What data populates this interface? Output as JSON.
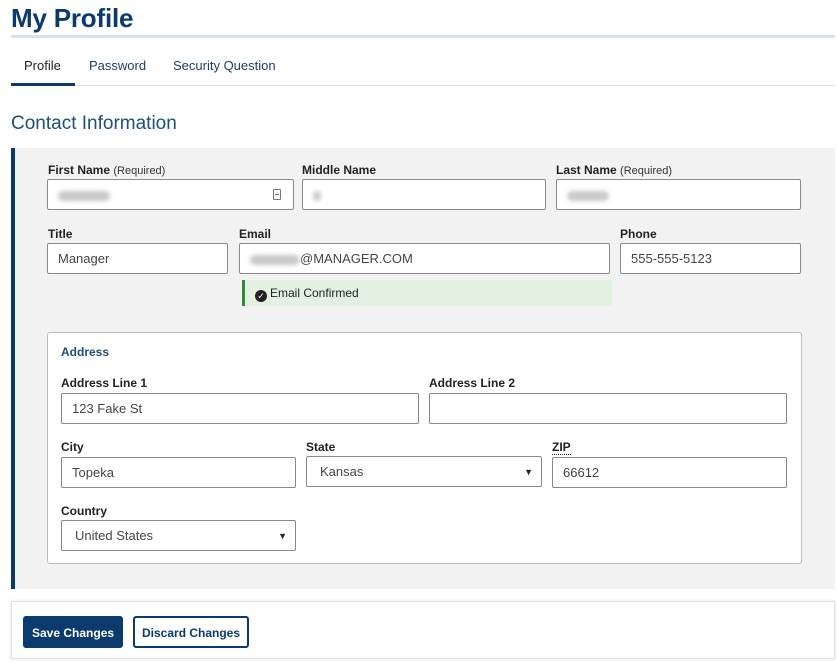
{
  "header": {
    "title": "My Profile"
  },
  "tabs": [
    {
      "label": "Profile",
      "active": true
    },
    {
      "label": "Password",
      "active": false
    },
    {
      "label": "Security Question",
      "active": false
    }
  ],
  "contact": {
    "title": "Contact Information",
    "first_name": {
      "label": "First Name",
      "required": "(Required)",
      "value": ""
    },
    "middle_name": {
      "label": "Middle Name",
      "value": ""
    },
    "last_name": {
      "label": "Last Name",
      "required": "(Required)",
      "value": ""
    },
    "title_field": {
      "label": "Title",
      "value": "Manager"
    },
    "email": {
      "label": "Email",
      "value_visible": "@MANAGER.COM"
    },
    "phone": {
      "label": "Phone",
      "value": "555-555-5123"
    },
    "email_status": "Email Confirmed"
  },
  "address": {
    "heading": "Address",
    "line1": {
      "label": "Address Line 1",
      "value": "123 Fake St"
    },
    "line2": {
      "label": "Address Line 2",
      "value": ""
    },
    "city": {
      "label": "City",
      "value": "Topeka"
    },
    "state": {
      "label": "State",
      "value": "Kansas"
    },
    "zip": {
      "label": "ZIP",
      "value": "66612"
    },
    "country": {
      "label": "Country",
      "value": "United States"
    }
  },
  "actions": {
    "save_label": "Save Changes",
    "discard_label": "Discard Changes"
  },
  "colors": {
    "brand": "#0b3a6e",
    "confirmed_bg": "#e3f1e3",
    "confirmed_border": "#2f8a3c",
    "panel_bg": "#f2f2f2"
  },
  "icons": {
    "check": "check-circle-icon",
    "select": "caret-down-icon",
    "autofill": "contact-card-icon"
  }
}
